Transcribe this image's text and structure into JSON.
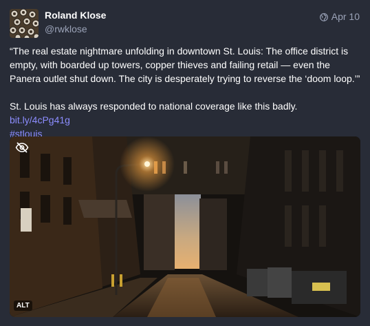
{
  "author": {
    "display_name": "Roland Klose",
    "handle": "@rwklose",
    "avatar_icon": "avatar-image"
  },
  "meta": {
    "visibility_icon": "globe-icon",
    "date": "Apr 10"
  },
  "content": {
    "quote": "“The real estate nightmare unfolding in downtown St. Louis: The office district is empty, with boarded up towers, copper thieves and failing retail — even the Panera outlet shut down. The city is desperately trying to reverse the ‘doom loop.’”",
    "body_text": "St. Louis has always responded to national coverage like this badly. ",
    "link_text": "bit.ly/4cPg41g",
    "hashtag": "#stlouis"
  },
  "media": {
    "hide_icon": "eye-slash-icon",
    "alt_badge": "ALT"
  },
  "colors": {
    "background": "#282c37",
    "secondary_text": "#9ba3b8",
    "link": "#8c8dff",
    "primary_text": "#ffffff"
  }
}
